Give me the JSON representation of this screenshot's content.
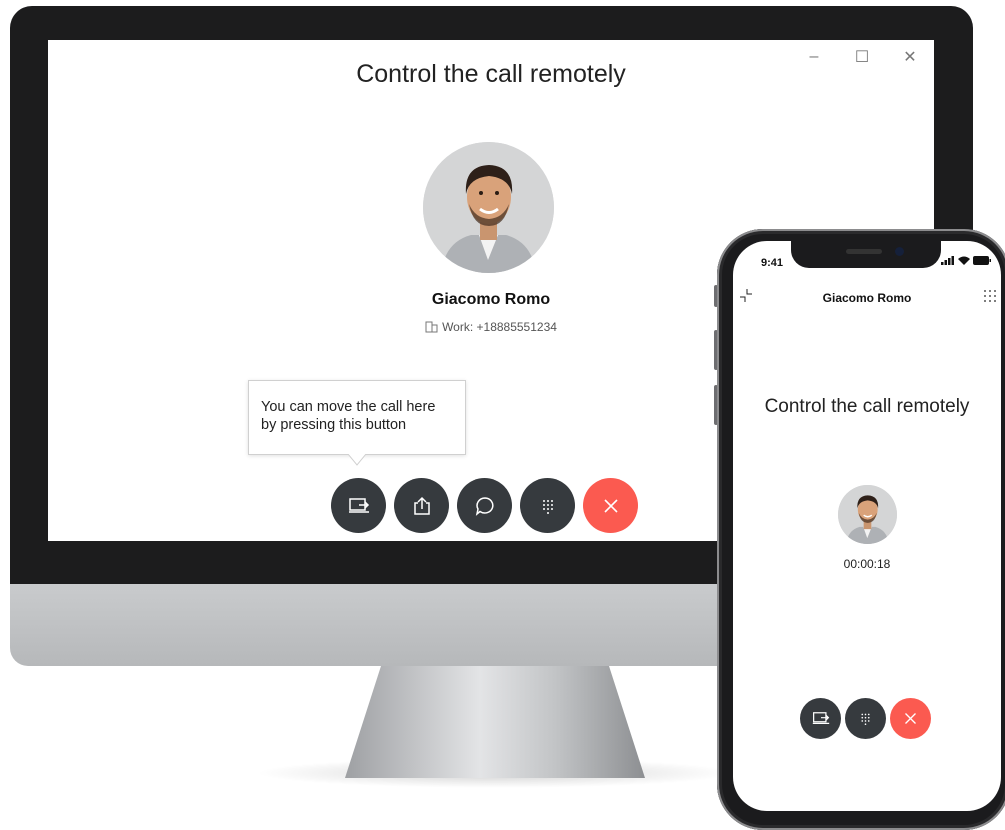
{
  "desktop": {
    "title": "Control the call remotely",
    "window_controls": {
      "minimize": "–",
      "maximize": "☐",
      "close": "✕"
    },
    "contact": {
      "name": "Giacomo Romo",
      "number_line": "Work: +18885551234"
    },
    "tooltip": {
      "text": "You can move the call here by pressing this button"
    },
    "controls": [
      {
        "name": "move-call-button",
        "icon": "move-call-icon"
      },
      {
        "name": "share-button",
        "icon": "share-icon"
      },
      {
        "name": "chat-button",
        "icon": "chat-bubble-icon"
      },
      {
        "name": "keypad-button",
        "icon": "keypad-icon"
      },
      {
        "name": "end-call-button",
        "icon": "close-icon",
        "color": "#fb5a50"
      }
    ]
  },
  "phone": {
    "status_time": "9:41",
    "header_name": "Giacomo Romo",
    "title": "Control the call remotely",
    "timer": "00:00:18",
    "controls": [
      {
        "name": "move-call-button",
        "icon": "move-call-icon"
      },
      {
        "name": "keypad-button",
        "icon": "keypad-icon"
      },
      {
        "name": "end-call-button",
        "icon": "close-icon",
        "color": "#fb5a50"
      }
    ]
  },
  "colors": {
    "control_dark": "#363a3e",
    "end_call": "#fb5a50",
    "bezel": "#1c1c1d"
  }
}
